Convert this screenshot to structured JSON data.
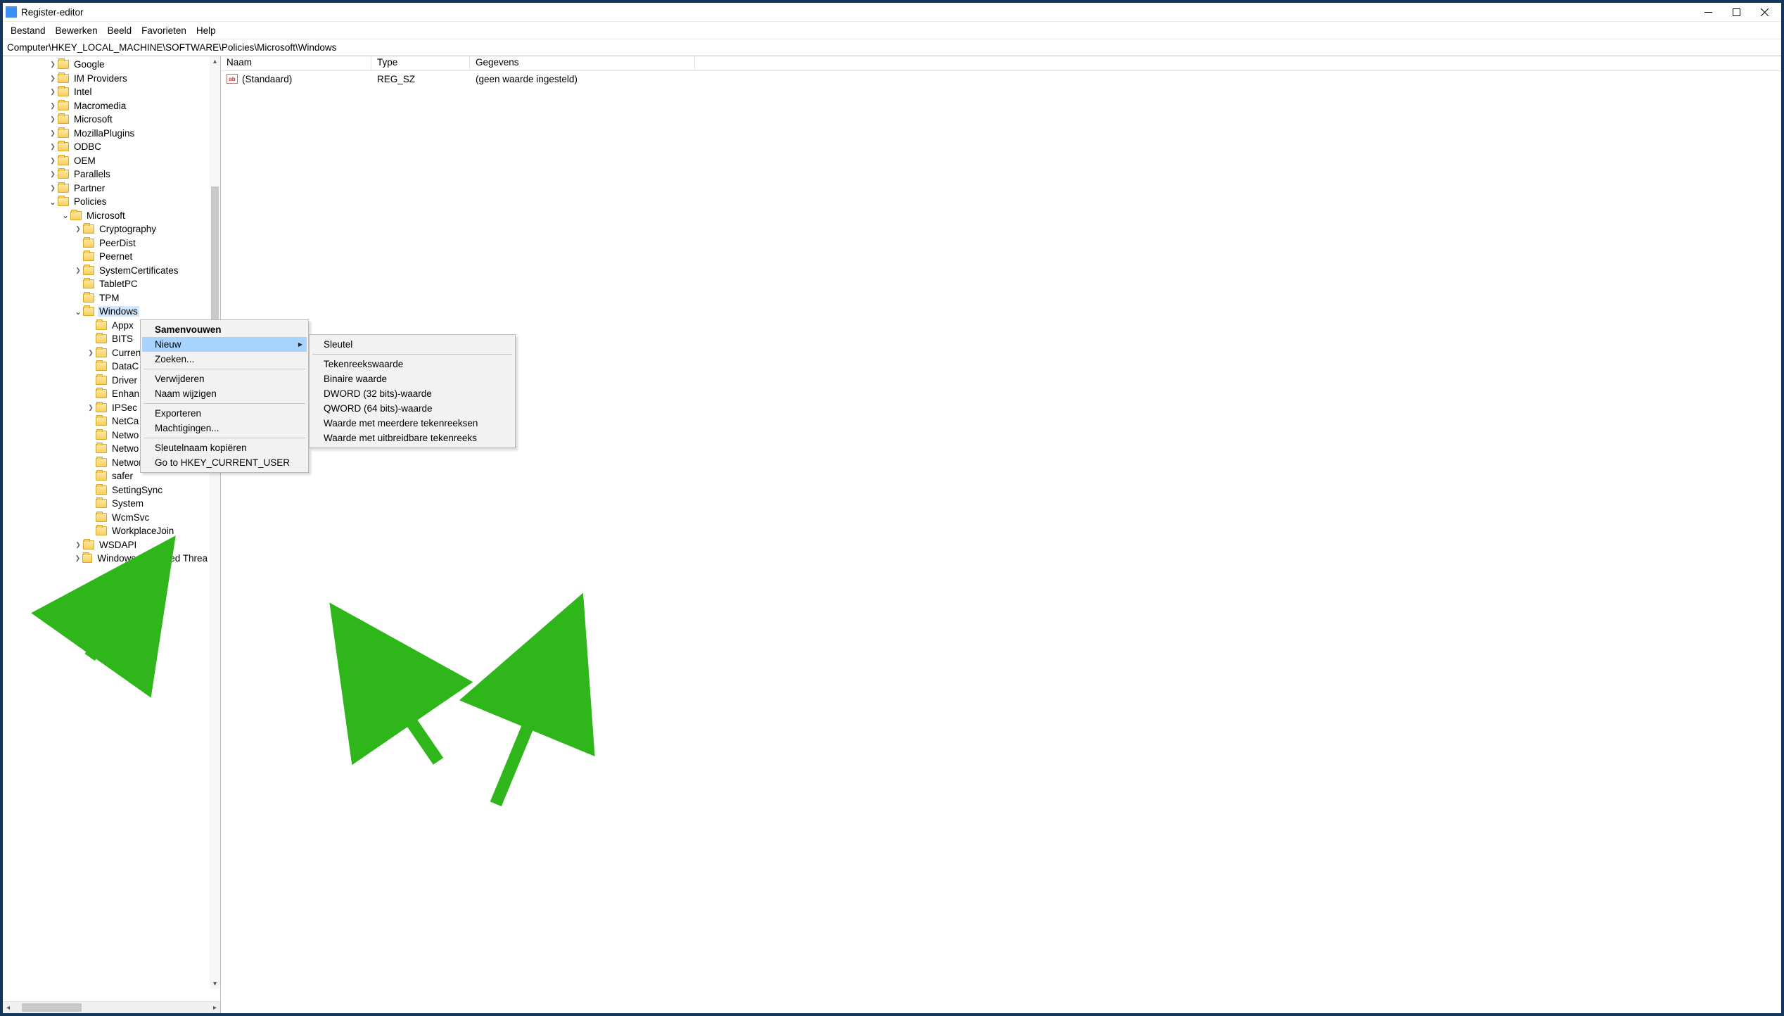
{
  "window": {
    "title": "Register-editor"
  },
  "menubar": {
    "items": [
      "Bestand",
      "Bewerken",
      "Beeld",
      "Favorieten",
      "Help"
    ]
  },
  "address": "Computer\\HKEY_LOCAL_MACHINE\\SOFTWARE\\Policies\\Microsoft\\Windows",
  "tree": {
    "items": [
      {
        "indent": 4,
        "caret": ">",
        "label": "Google"
      },
      {
        "indent": 4,
        "caret": ">",
        "label": "IM Providers"
      },
      {
        "indent": 4,
        "caret": ">",
        "label": "Intel"
      },
      {
        "indent": 4,
        "caret": ">",
        "label": "Macromedia"
      },
      {
        "indent": 4,
        "caret": ">",
        "label": "Microsoft"
      },
      {
        "indent": 4,
        "caret": ">",
        "label": "MozillaPlugins"
      },
      {
        "indent": 4,
        "caret": ">",
        "label": "ODBC"
      },
      {
        "indent": 4,
        "caret": ">",
        "label": "OEM"
      },
      {
        "indent": 4,
        "caret": ">",
        "label": "Parallels"
      },
      {
        "indent": 4,
        "caret": ">",
        "label": "Partner"
      },
      {
        "indent": 4,
        "caret": "v",
        "label": "Policies"
      },
      {
        "indent": 5,
        "caret": "v",
        "label": "Microsoft"
      },
      {
        "indent": 6,
        "caret": ">",
        "label": "Cryptography"
      },
      {
        "indent": 6,
        "caret": "",
        "label": "PeerDist"
      },
      {
        "indent": 6,
        "caret": "",
        "label": "Peernet"
      },
      {
        "indent": 6,
        "caret": ">",
        "label": "SystemCertificates"
      },
      {
        "indent": 6,
        "caret": "",
        "label": "TabletPC"
      },
      {
        "indent": 6,
        "caret": "",
        "label": "TPM"
      },
      {
        "indent": 6,
        "caret": "v",
        "label": "Windows",
        "selected": true
      },
      {
        "indent": 7,
        "caret": "",
        "label": "Appx"
      },
      {
        "indent": 7,
        "caret": "",
        "label": "BITS"
      },
      {
        "indent": 7,
        "caret": ">",
        "label": "Curren"
      },
      {
        "indent": 7,
        "caret": "",
        "label": "DataC"
      },
      {
        "indent": 7,
        "caret": "",
        "label": "Driver"
      },
      {
        "indent": 7,
        "caret": "",
        "label": "Enhan"
      },
      {
        "indent": 7,
        "caret": ">",
        "label": "IPSec"
      },
      {
        "indent": 7,
        "caret": "",
        "label": "NetCa"
      },
      {
        "indent": 7,
        "caret": "",
        "label": "Netwo"
      },
      {
        "indent": 7,
        "caret": "",
        "label": "Netwo"
      },
      {
        "indent": 7,
        "caret": "",
        "label": "NetworkProvider"
      },
      {
        "indent": 7,
        "caret": "",
        "label": "safer"
      },
      {
        "indent": 7,
        "caret": "",
        "label": "SettingSync"
      },
      {
        "indent": 7,
        "caret": "",
        "label": "System"
      },
      {
        "indent": 7,
        "caret": "",
        "label": "WcmSvc"
      },
      {
        "indent": 7,
        "caret": "",
        "label": "WorkplaceJoin"
      },
      {
        "indent": 6,
        "caret": ">",
        "label": "WSDAPI"
      },
      {
        "indent": 6,
        "caret": ">",
        "label": "Windows Advanced Threa"
      }
    ]
  },
  "list": {
    "columns": [
      "Naam",
      "Type",
      "Gegevens"
    ],
    "rows": [
      {
        "name": "(Standaard)",
        "type": "REG_SZ",
        "data": "(geen waarde ingesteld)"
      }
    ]
  },
  "context_menu_1": {
    "items": [
      {
        "label": "Samenvouwen",
        "bold": true
      },
      {
        "label": "Nieuw",
        "highlight": true,
        "submenu": true
      },
      {
        "label": "Zoeken..."
      },
      {
        "sep": true
      },
      {
        "label": "Verwijderen"
      },
      {
        "label": "Naam wijzigen"
      },
      {
        "sep": true
      },
      {
        "label": "Exporteren"
      },
      {
        "label": "Machtigingen..."
      },
      {
        "sep": true
      },
      {
        "label": "Sleutelnaam kopiëren"
      },
      {
        "label": "Go to HKEY_CURRENT_USER"
      }
    ]
  },
  "context_menu_2": {
    "items": [
      {
        "label": "Sleutel"
      },
      {
        "sep": true
      },
      {
        "label": "Tekenreekswaarde"
      },
      {
        "label": "Binaire waarde"
      },
      {
        "label": "DWORD (32 bits)-waarde"
      },
      {
        "label": "QWORD (64 bits)-waarde"
      },
      {
        "label": "Waarde met meerdere tekenreeksen"
      },
      {
        "label": "Waarde met uitbreidbare tekenreeks"
      }
    ]
  },
  "icons": {
    "string_icon_text": "ab"
  }
}
